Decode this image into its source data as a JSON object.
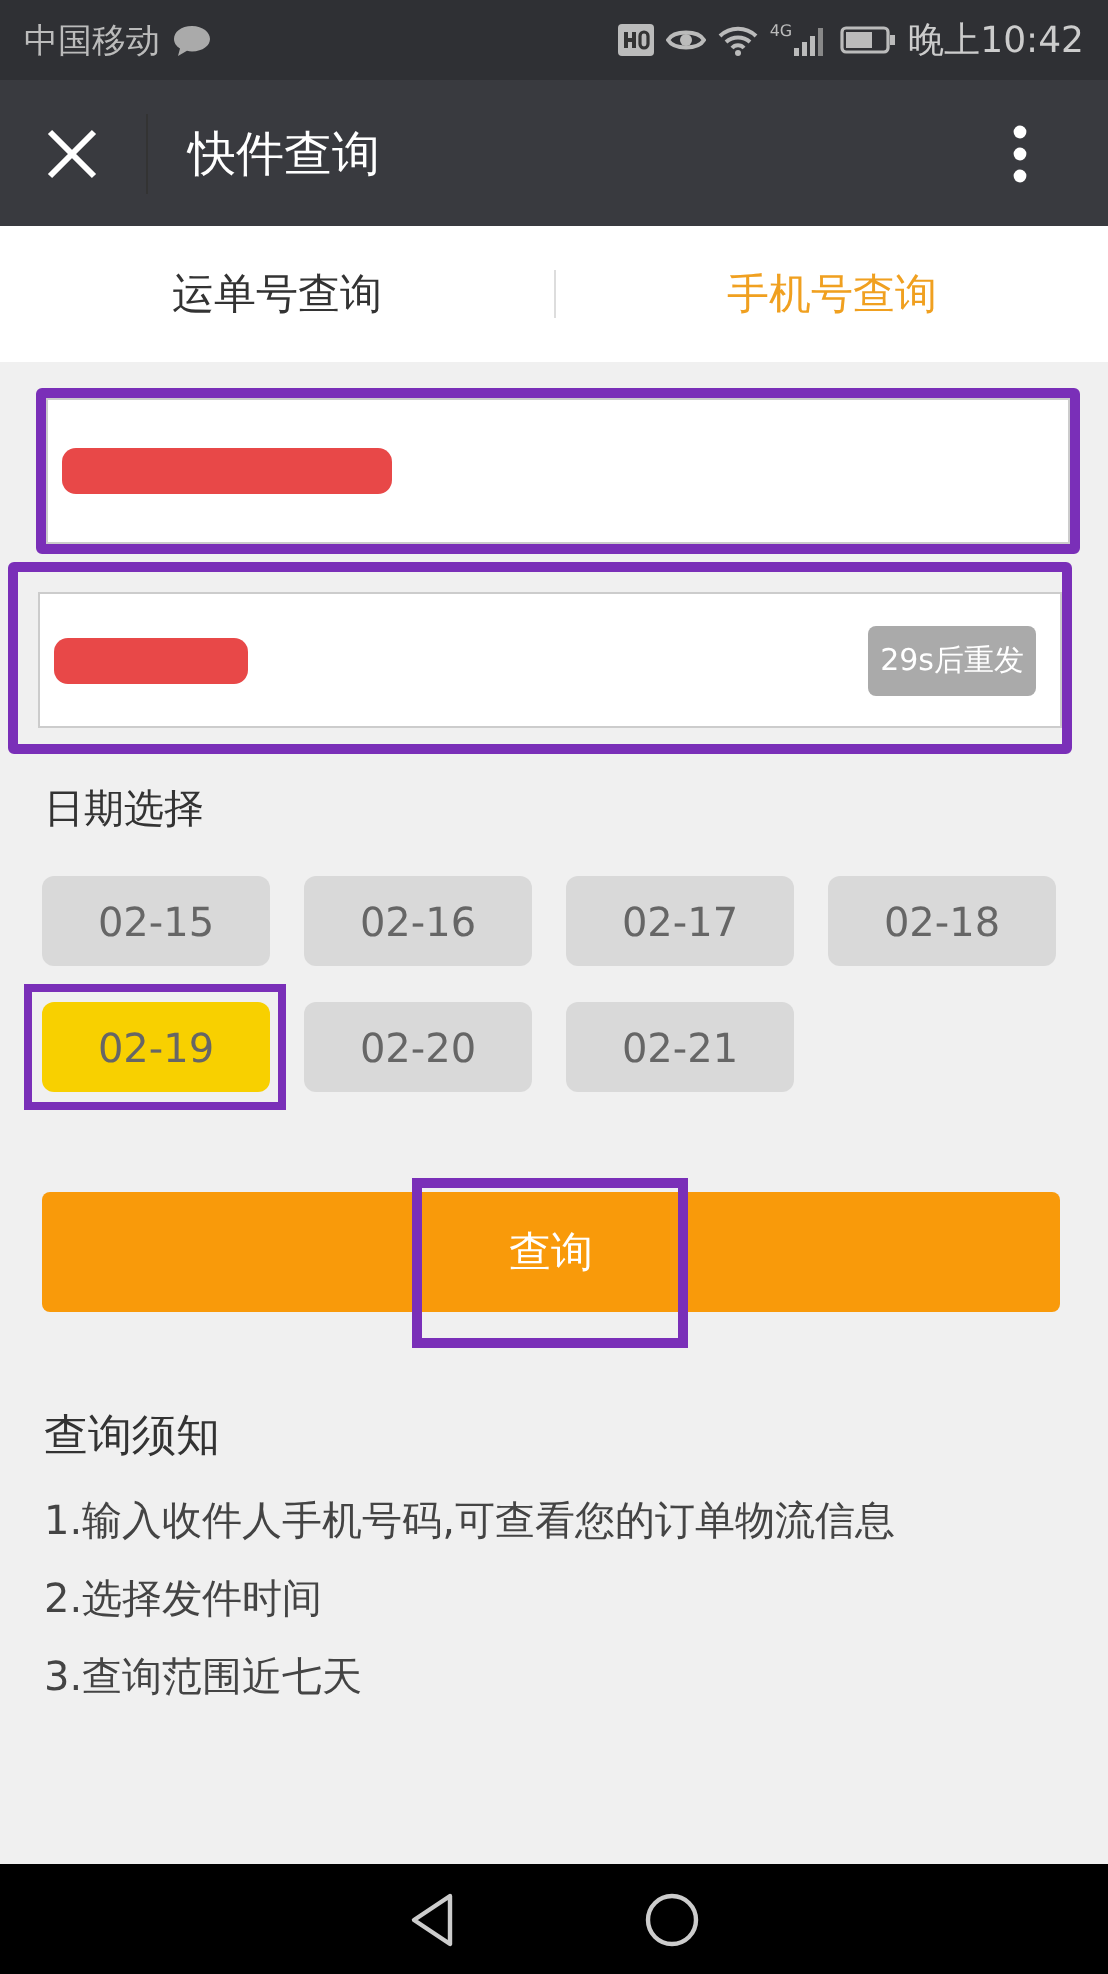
{
  "status_bar": {
    "carrier": "中国移动",
    "time": "晚上10:42",
    "network": "4G"
  },
  "title_bar": {
    "title": "快件查询"
  },
  "tabs": [
    {
      "label": "运单号查询",
      "selected": false
    },
    {
      "label": "手机号查询",
      "selected": true
    }
  ],
  "fields": [
    {
      "kind": "phone",
      "redacted": true,
      "highlighted": true
    },
    {
      "kind": "code",
      "redacted": true,
      "highlighted": true,
      "resend": "29s后重发"
    }
  ],
  "date_label": "日期选择",
  "dates": [
    {
      "label": "02-15",
      "selected": false,
      "highlighted": false
    },
    {
      "label": "02-16",
      "selected": false,
      "highlighted": false
    },
    {
      "label": "02-17",
      "selected": false,
      "highlighted": false
    },
    {
      "label": "02-18",
      "selected": false,
      "highlighted": false
    },
    {
      "label": "02-19",
      "selected": true,
      "highlighted": true
    },
    {
      "label": "02-20",
      "selected": false,
      "highlighted": false
    },
    {
      "label": "02-21",
      "selected": false,
      "highlighted": false
    }
  ],
  "query_button": {
    "label": "查询",
    "highlighted": true
  },
  "notice": {
    "title": "查询须知",
    "items": [
      "1.输入收件人手机号码,可查看您的订单物流信息",
      "2.选择发件时间",
      "3.查询范围近七天"
    ]
  }
}
